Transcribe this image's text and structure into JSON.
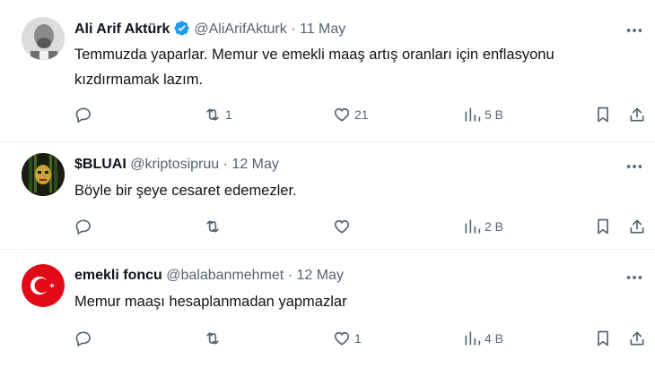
{
  "colors": {
    "text": "#0f1419",
    "muted": "#536471",
    "verified": "#1d9bf0",
    "divider": "#eff3f4",
    "flag": "#e30a17"
  },
  "tweets": [
    {
      "name": "Ali Arif Aktürk",
      "verified": true,
      "handle": "@AliArifAkturk",
      "sep": "·",
      "date": "11 May",
      "text": "Temmuzda yaparlar. Memur ve emekli maaş artış oranları için enflasyonu kızdırmamak lazım.",
      "replies": "",
      "retweets": "1",
      "likes": "21",
      "views": "5 B"
    },
    {
      "name": "$BLUAI",
      "verified": false,
      "handle": "@kriptosipruu",
      "sep": "·",
      "date": "12 May",
      "text": "Böyle bir şeye cesaret edemezler.",
      "replies": "",
      "retweets": "",
      "likes": "",
      "views": "2 B"
    },
    {
      "name": "emekli foncu",
      "verified": false,
      "handle": "@balabanmehmet",
      "sep": "·",
      "date": "12 May",
      "text": "Memur maaşı hesaplanmadan yapmazlar",
      "replies": "",
      "retweets": "",
      "likes": "1",
      "views": "4 B"
    }
  ]
}
